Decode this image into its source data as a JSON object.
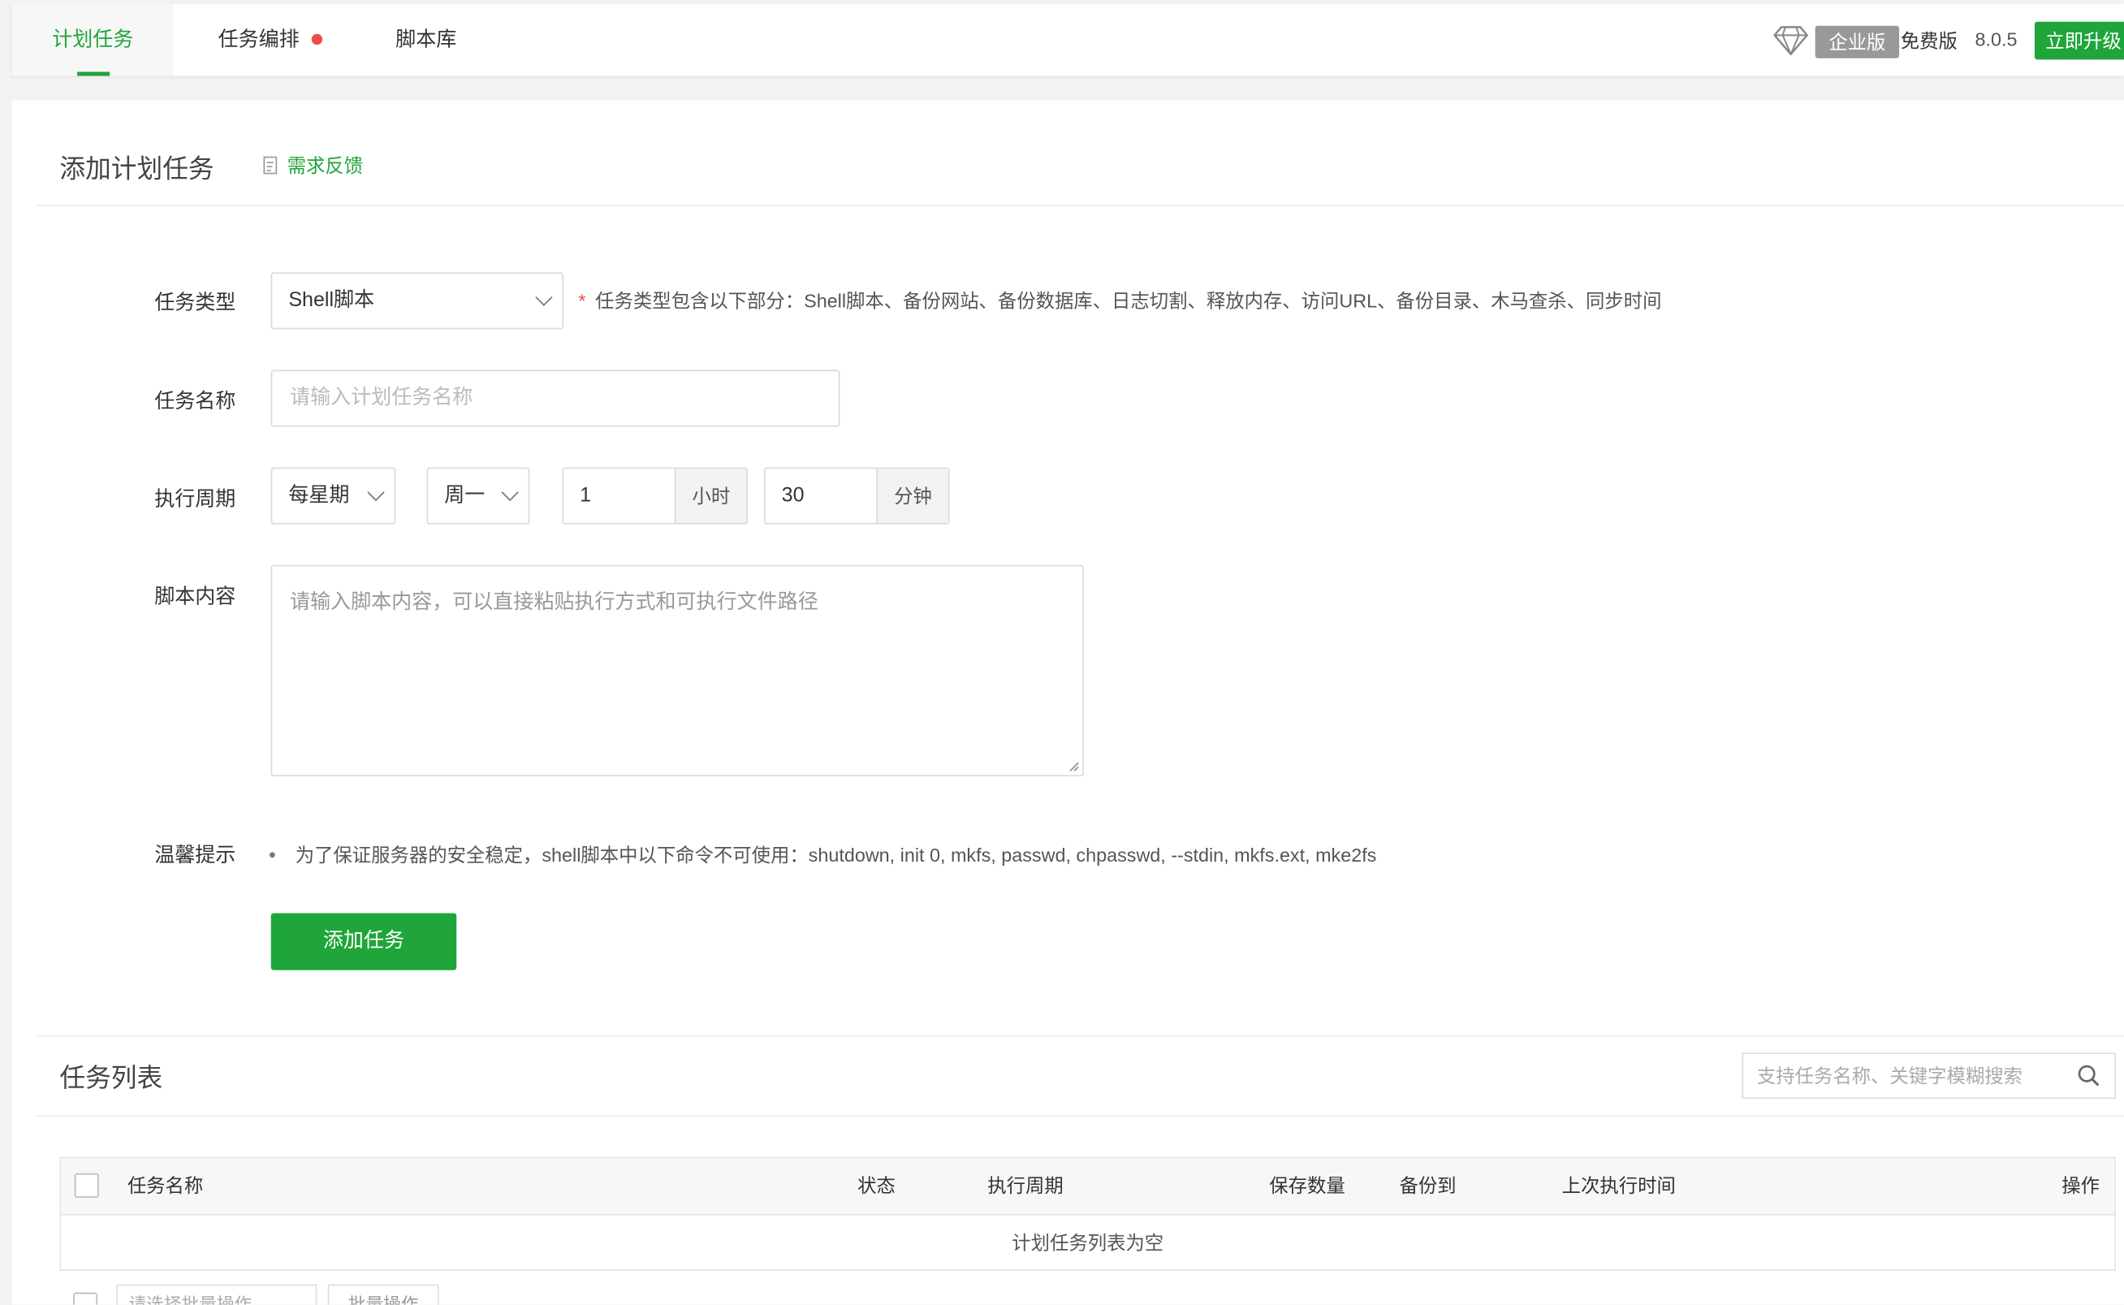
{
  "tabs": [
    {
      "label": "计划任务",
      "active": true
    },
    {
      "label": "任务编排",
      "dot": true
    },
    {
      "label": "脚本库"
    }
  ],
  "top_right": {
    "edition_badge": "企业版",
    "free_label": "免费版",
    "version": "8.0.5",
    "upgrade_button": "立即升级"
  },
  "add_section": {
    "title": "添加计划任务",
    "feedback_link": "需求反馈",
    "task_type": {
      "label": "任务类型",
      "selected": "Shell脚本",
      "hint": "任务类型包含以下部分：Shell脚本、备份网站、备份数据库、日志切割、释放内存、访问URL、备份目录、木马查杀、同步时间"
    },
    "task_name": {
      "label": "任务名称",
      "placeholder": "请输入计划任务名称"
    },
    "cycle": {
      "label": "执行周期",
      "period": "每星期",
      "weekday": "周一",
      "hour_value": "1",
      "hour_unit": "小时",
      "minute_value": "30",
      "minute_unit": "分钟"
    },
    "script": {
      "label": "脚本内容",
      "placeholder": "请输入脚本内容，可以直接粘贴执行方式和可执行文件路径"
    },
    "tip": {
      "label": "温馨提示",
      "text": "为了保证服务器的安全稳定，shell脚本中以下命令不可使用：shutdown, init 0, mkfs, passwd, chpasswd, --stdin, mkfs.ext, mke2fs"
    },
    "add_button": "添加任务"
  },
  "list_section": {
    "title": "任务列表",
    "search_placeholder": "支持任务名称、关键字模糊搜索",
    "columns": [
      "任务名称",
      "状态",
      "执行周期",
      "保存数量",
      "备份到",
      "上次执行时间",
      "操作"
    ],
    "empty_text": "计划任务列表为空",
    "batch_select": "请选择批量操作",
    "batch_button": "批量操作"
  },
  "colors": {
    "accent": "#20a53a",
    "dot": "#ef4a4a",
    "badge": "#999999"
  }
}
